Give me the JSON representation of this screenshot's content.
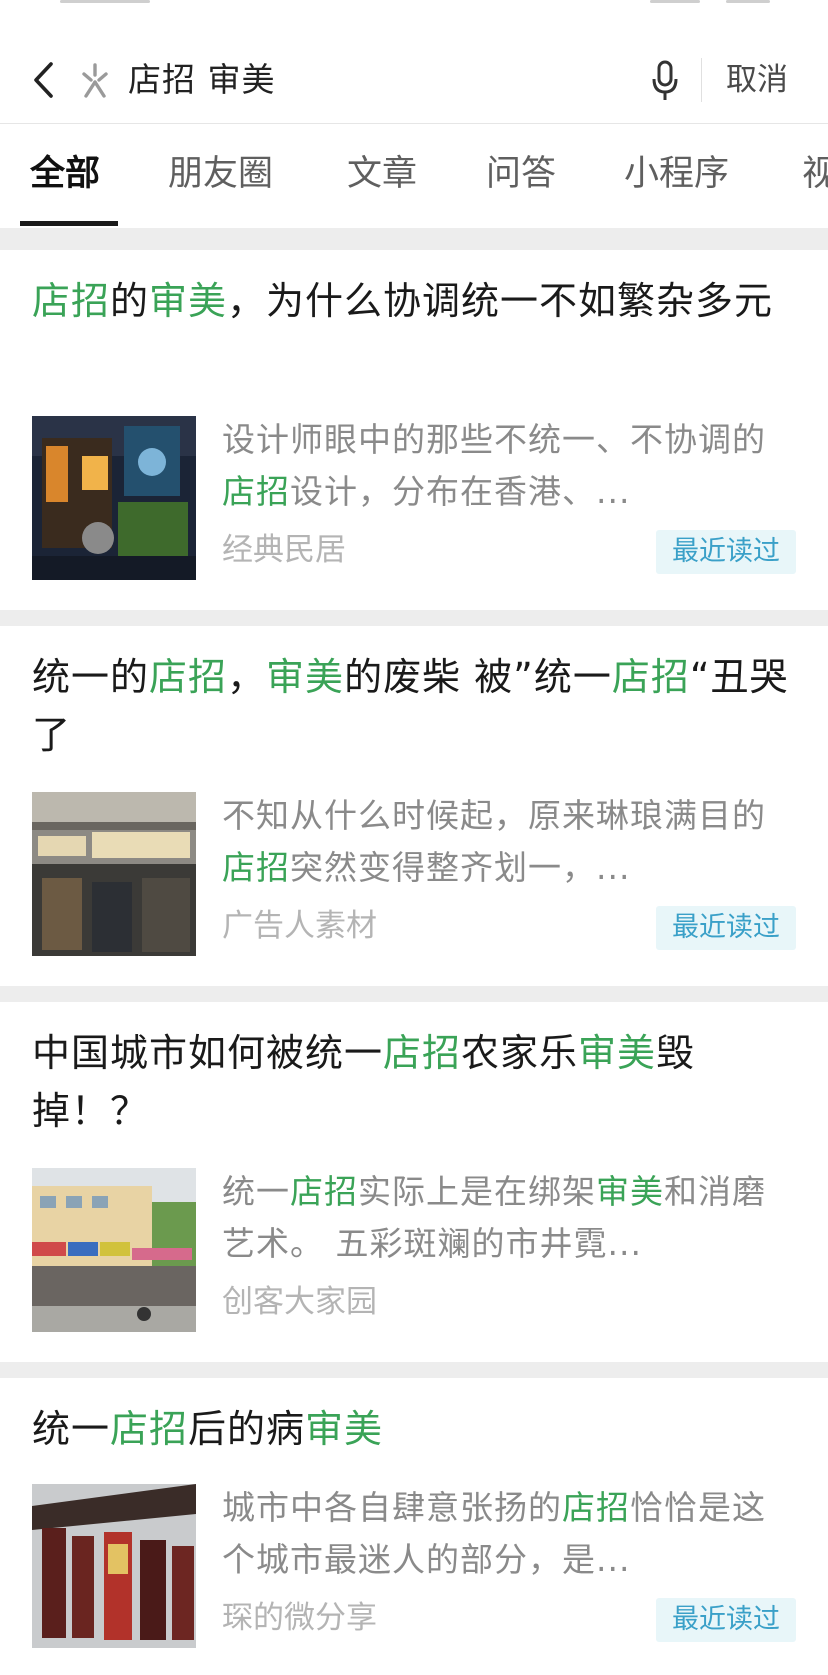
{
  "search": {
    "query": "店招 审美",
    "cancel_label": "取消"
  },
  "tabs": [
    {
      "label": "全部",
      "active": true
    },
    {
      "label": "朋友圈",
      "active": false
    },
    {
      "label": "文章",
      "active": false
    },
    {
      "label": "问答",
      "active": false
    },
    {
      "label": "小程序",
      "active": false
    },
    {
      "label": "视",
      "active": false
    }
  ],
  "results": [
    {
      "title": [
        {
          "text": "店招",
          "hl": true
        },
        {
          "text": "的",
          "hl": false
        },
        {
          "text": "审美",
          "hl": true
        },
        {
          "text": "，为什么协调统一不如繁杂多元",
          "hl": false
        }
      ],
      "snippet": [
        {
          "text": "设计师眼中的那些不统一、不协调的",
          "hl": false
        },
        {
          "text": "店招",
          "hl": true
        },
        {
          "text": "设计，分布在香港、...",
          "hl": false
        }
      ],
      "source": "经典民居",
      "badge": "最近读过",
      "thumbnail": "night-street-signs-photo"
    },
    {
      "title": [
        {
          "text": "统一的",
          "hl": false
        },
        {
          "text": "店招",
          "hl": true
        },
        {
          "text": "，",
          "hl": false
        },
        {
          "text": "审美",
          "hl": true
        },
        {
          "text": "的废柴 被”统一",
          "hl": false
        },
        {
          "text": "店招",
          "hl": true
        },
        {
          "text": "“丑哭了",
          "hl": false
        }
      ],
      "snippet": [
        {
          "text": "不知从什么时候起，原来琳琅满目的",
          "hl": false
        },
        {
          "text": "店招",
          "hl": true
        },
        {
          "text": "突然变得整齐划一，...",
          "hl": false
        }
      ],
      "source": "广告人素材",
      "badge": "最近读过",
      "thumbnail": "storefront-row-photo"
    },
    {
      "title": [
        {
          "text": "中国城市如何被统一",
          "hl": false
        },
        {
          "text": "店招",
          "hl": true
        },
        {
          "text": "农家乐",
          "hl": false
        },
        {
          "text": "审美",
          "hl": true
        },
        {
          "text": "毁掉！？",
          "hl": false
        }
      ],
      "snippet": [
        {
          "text": "统一",
          "hl": false
        },
        {
          "text": "店招",
          "hl": true
        },
        {
          "text": "实际上是在绑架",
          "hl": false
        },
        {
          "text": "审美",
          "hl": true
        },
        {
          "text": "和消磨艺术。 五彩斑斓的市井霓...",
          "hl": false
        }
      ],
      "source": "创客大家园",
      "badge": "",
      "thumbnail": "street-buildings-photo"
    },
    {
      "title": [
        {
          "text": "统一",
          "hl": false
        },
        {
          "text": "店招",
          "hl": true
        },
        {
          "text": "后的病",
          "hl": false
        },
        {
          "text": "审美",
          "hl": true
        }
      ],
      "snippet": [
        {
          "text": "城市中各自肆意张扬的",
          "hl": false
        },
        {
          "text": "店招",
          "hl": true
        },
        {
          "text": "恰恰是这个城市最迷人的部分，是...",
          "hl": false
        }
      ],
      "source": "琛的微分享",
      "badge": "最近读过",
      "thumbnail": "traditional-building-signs-photo"
    }
  ],
  "colors": {
    "highlight": "#3aa357",
    "badge_bg": "#e8f6f9",
    "badge_text": "#3aa0c8",
    "separator": "#ededed"
  }
}
